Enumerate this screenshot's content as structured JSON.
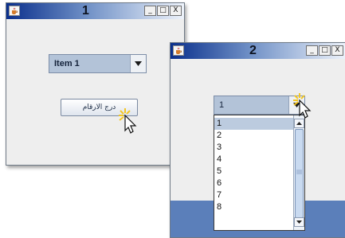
{
  "window1": {
    "title": "1",
    "combo_value": "Item 1",
    "button_label": "درج الارقام",
    "controls": [
      "_",
      "□",
      "X"
    ]
  },
  "window2": {
    "title": "2",
    "combo_value": "1",
    "controls": [
      "_",
      "□",
      "X"
    ],
    "list_items": [
      "1",
      "2",
      "3",
      "4",
      "5",
      "6",
      "7",
      "8"
    ],
    "selected_index": 0
  },
  "colors": {
    "titlebar_dark": "#0a2f8c",
    "combo_selection": "#b3c3d8",
    "list_selection": "#bccbdf",
    "bottom_band": "#5b7fba"
  },
  "icons": [
    "java-cup-icon",
    "minimize-icon",
    "maximize-icon",
    "close-icon",
    "dropdown-arrow-icon",
    "scroll-up-icon",
    "scroll-down-icon",
    "click-pointer-icon"
  ]
}
